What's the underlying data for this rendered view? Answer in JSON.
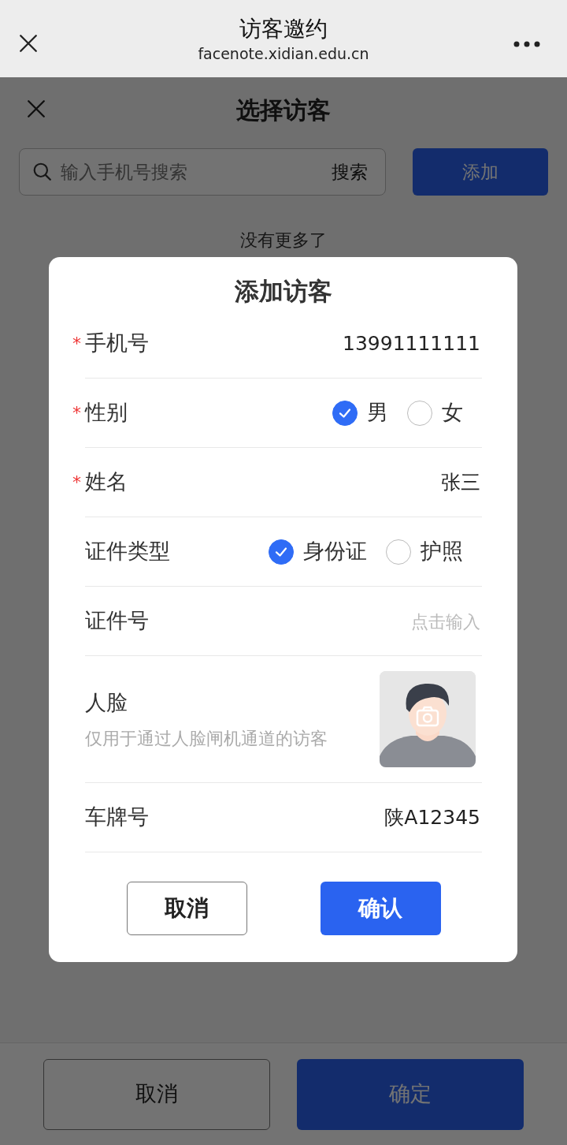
{
  "browser": {
    "title": "访客邀约",
    "url": "facenote.xidian.edu.cn"
  },
  "page": {
    "title": "选择访客",
    "search": {
      "placeholder": "输入手机号搜索",
      "button": "搜索"
    },
    "add_button": "添加",
    "list_end": "没有更多了",
    "footer_buttons": [
      {
        "label": "取消",
        "kind": "outline"
      },
      {
        "label": "确定",
        "kind": "primary"
      }
    ]
  },
  "dialog": {
    "title": "添加访客",
    "fields": [
      {
        "kind": "text",
        "label": "手机号",
        "required_mark": "*",
        "value": "13991111111"
      },
      {
        "kind": "radio",
        "label": "性别",
        "required_mark": "*",
        "options": [
          {
            "label": "男",
            "selected": true
          },
          {
            "label": "女",
            "selected": false
          }
        ]
      },
      {
        "kind": "text",
        "label": "姓名",
        "required_mark": "*",
        "value": "张三"
      },
      {
        "kind": "radio",
        "label": "证件类型",
        "options": [
          {
            "label": "身份证",
            "selected": true
          },
          {
            "label": "护照",
            "selected": false
          }
        ]
      },
      {
        "kind": "text",
        "label": "证件号",
        "placeholder": "点击输入"
      },
      {
        "kind": "photo",
        "label": "人脸",
        "hint": "仅用于通过人脸闸机通道的访客"
      },
      {
        "kind": "text",
        "label": "车牌号",
        "value": "陕A12345"
      }
    ],
    "buttons": [
      {
        "label": "取消",
        "kind": "outline"
      },
      {
        "label": "确认",
        "kind": "primary"
      }
    ]
  }
}
